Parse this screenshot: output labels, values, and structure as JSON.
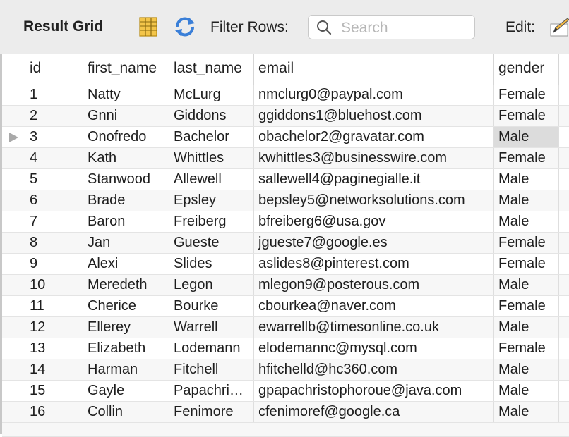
{
  "toolbar": {
    "title": "Result Grid",
    "filter_label": "Filter Rows:",
    "search_placeholder": "Search",
    "edit_label": "Edit:",
    "icons": [
      "grid-layout-icon",
      "refresh-icon",
      "search-icon",
      "edit-pencil-icon"
    ]
  },
  "grid": {
    "columns": [
      "id",
      "first_name",
      "last_name",
      "email",
      "gender"
    ],
    "selected_row": 2,
    "rows": [
      [
        "1",
        "Natty",
        "McLurg",
        "nmclurg0@paypal.com",
        "Female"
      ],
      [
        "2",
        "Gnni",
        "Giddons",
        "ggiddons1@bluehost.com",
        "Female"
      ],
      [
        "3",
        "Onofredo",
        "Bachelor",
        "obachelor2@gravatar.com",
        "Male"
      ],
      [
        "4",
        "Kath",
        "Whittles",
        "kwhittles3@businesswire.com",
        "Female"
      ],
      [
        "5",
        "Stanwood",
        "Allewell",
        "sallewell4@paginegialle.it",
        "Male"
      ],
      [
        "6",
        "Brade",
        "Epsley",
        "bepsley5@networksolutions.com",
        "Male"
      ],
      [
        "7",
        "Baron",
        "Freiberg",
        "bfreiberg6@usa.gov",
        "Male"
      ],
      [
        "8",
        "Jan",
        "Gueste",
        "jgueste7@google.es",
        "Female"
      ],
      [
        "9",
        "Alexi",
        "Slides",
        "aslides8@pinterest.com",
        "Female"
      ],
      [
        "10",
        "Meredeth",
        "Legon",
        "mlegon9@posterous.com",
        "Male"
      ],
      [
        "11",
        "Cherice",
        "Bourke",
        "cbourkea@naver.com",
        "Female"
      ],
      [
        "12",
        "Ellerey",
        "Warrell",
        "ewarrellb@timesonline.co.uk",
        "Male"
      ],
      [
        "13",
        "Elizabeth",
        "Lodemann",
        "elodemannc@mysql.com",
        "Female"
      ],
      [
        "14",
        "Harman",
        "Fitchell",
        "hfitchelld@hc360.com",
        "Male"
      ],
      [
        "15",
        "Gayle",
        "Papachri…",
        "gpapachristophoroue@java.com",
        "Male"
      ],
      [
        "16",
        "Collin",
        "Fenimore",
        "cfenimoref@google.ca",
        "Male"
      ]
    ]
  }
}
